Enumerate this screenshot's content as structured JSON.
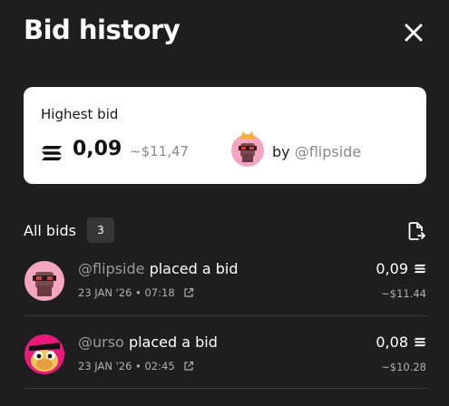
{
  "header": {
    "title": "Bid history",
    "close_icon": "close-icon"
  },
  "highest_bid": {
    "label": "Highest bid",
    "price": "0,09",
    "usd": "~$11,47",
    "by_prefix": "by",
    "handle": "@flipside",
    "currency_icon": "solana-icon"
  },
  "bids": {
    "label": "All bids",
    "count": "3",
    "export_icon": "export-file-icon",
    "items": [
      {
        "handle": "@flipside",
        "action": "placed a bid",
        "date": "23 JAN '26 • 07:18",
        "price": "0,09",
        "usd": "~$11.44"
      },
      {
        "handle": "@urso",
        "action": "placed a bid",
        "date": "23 JAN '26 • 02:45",
        "price": "0,08",
        "usd": "~$10.28"
      }
    ]
  },
  "colors": {
    "background": "#1e1e1e",
    "card": "#ffffff",
    "muted": "#8a8a8a",
    "avatar_pink": "#f6a5c0",
    "avatar_magenta": "#e8197a"
  }
}
